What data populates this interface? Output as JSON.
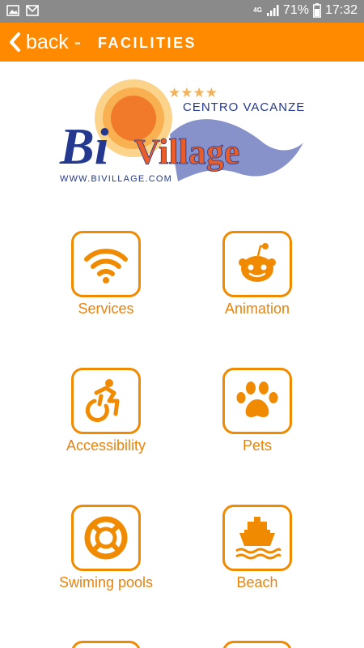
{
  "status_bar": {
    "left_icons": [
      "image-icon",
      "mail-icon"
    ],
    "network": "4G",
    "battery": "71%",
    "time": "17:32"
  },
  "header": {
    "back_label": "back -",
    "title": "FACILITIES",
    "color": "#ff8a00"
  },
  "logo": {
    "stars": "★★★★",
    "tagline": "CENTRO VACANZE",
    "brand_bi": "Bi",
    "brand_village": "Village",
    "url": "WWW.BIVILLAGE.COM"
  },
  "facilities": [
    {
      "label": "Services",
      "icon": "wifi-icon"
    },
    {
      "label": "Animation",
      "icon": "smiley-robot-icon"
    },
    {
      "label": "Accessibility",
      "icon": "wheelchair-icon"
    },
    {
      "label": "Pets",
      "icon": "paw-icon"
    },
    {
      "label": "Swiming pools",
      "icon": "life-ring-icon"
    },
    {
      "label": "Beach",
      "icon": "ship-icon"
    }
  ],
  "accent_color": "#f08a00"
}
